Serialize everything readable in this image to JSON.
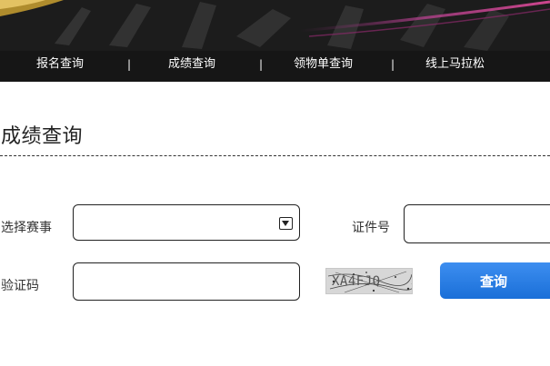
{
  "nav": {
    "items": [
      {
        "label": "报名查询"
      },
      {
        "label": "成绩查询"
      },
      {
        "label": "领物单查询"
      },
      {
        "label": "线上马拉松"
      }
    ],
    "separator": "|"
  },
  "page_title": "成绩查询",
  "form": {
    "event_label": "选择赛事",
    "event_value": "",
    "id_label": "证件号",
    "id_value": "",
    "captcha_label": "验证码",
    "captcha_value": "",
    "captcha_image_text": "XA4FJQ",
    "submit_label": "查询"
  },
  "colors": {
    "banner": "#1c1c1c",
    "nav_text": "#ffffff",
    "button": "#2a7de6"
  }
}
